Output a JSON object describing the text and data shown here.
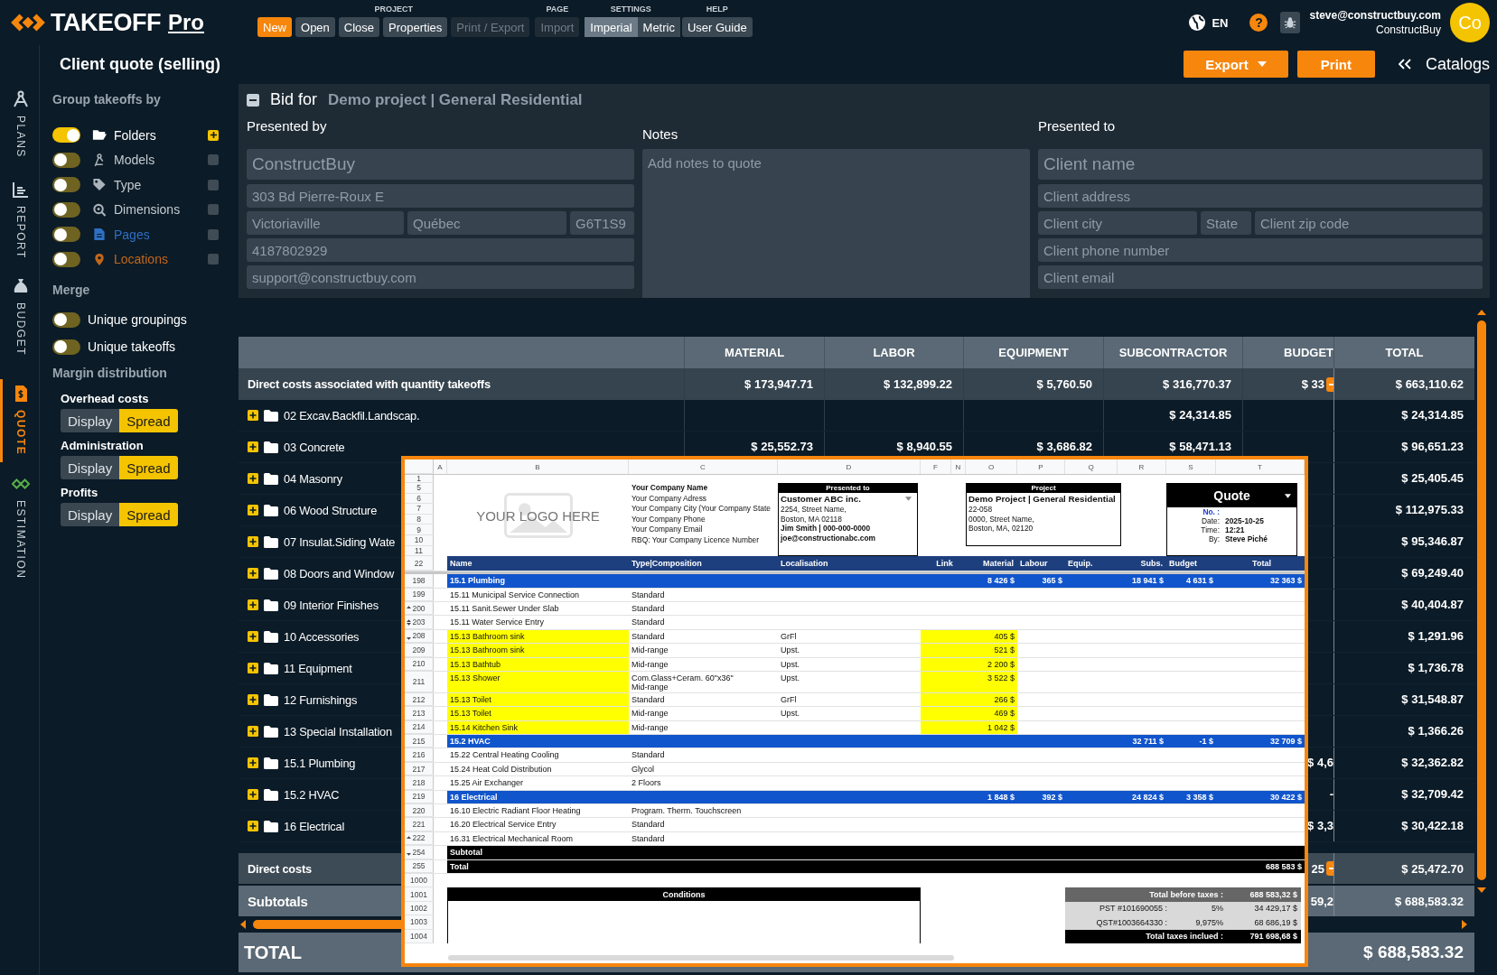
{
  "topbar": {
    "logo": {
      "name": "TAKEOFF",
      "suffix": "Pro"
    },
    "groups": [
      {
        "label": "PROJECT",
        "buttons": [
          {
            "label": "New",
            "kind": "accent",
            "selected": false,
            "disabled": false
          },
          {
            "label": "Open",
            "kind": "plain",
            "selected": false,
            "disabled": false
          },
          {
            "label": "Close",
            "kind": "plain",
            "selected": false,
            "disabled": false
          },
          {
            "label": "Properties",
            "kind": "plain",
            "selected": false,
            "disabled": false
          },
          {
            "label": "Print / Export",
            "kind": "plain",
            "selected": false,
            "disabled": true
          }
        ]
      },
      {
        "label": "PAGE",
        "buttons": [
          {
            "label": "Import",
            "kind": "plain",
            "selected": false,
            "disabled": true
          }
        ]
      },
      {
        "label": "SETTINGS",
        "buttons": [
          {
            "label": "Imperial",
            "kind": "segment",
            "selected": true,
            "disabled": false
          },
          {
            "label": "Metric",
            "kind": "segment",
            "selected": false,
            "disabled": false
          }
        ]
      },
      {
        "label": "HELP",
        "buttons": [
          {
            "label": "User Guide",
            "kind": "plain",
            "selected": false,
            "disabled": false
          }
        ]
      }
    ],
    "language": "EN",
    "help": "?",
    "user": {
      "email": "steve@constructbuy.com",
      "company": "ConstructBuy",
      "initials": "Co"
    }
  },
  "rail": [
    {
      "label": "PLANS",
      "selected": false
    },
    {
      "label": "REPORT",
      "selected": false
    },
    {
      "label": "BUDGET",
      "selected": false
    },
    {
      "label": "QUOTE",
      "selected": true
    },
    {
      "label": "ESTIMATION",
      "selected": false
    }
  ],
  "header": {
    "title": "Client quote (selling)",
    "export": "Export",
    "print": "Print",
    "catalogs": "Catalogs"
  },
  "sidebar": {
    "group_title": "Group takeoffs by",
    "groupings": [
      {
        "label": "Folders",
        "on": true,
        "checked": true,
        "color": "#ffffff"
      },
      {
        "label": "Models",
        "on": false,
        "checked": false,
        "color": "#c3cbd2"
      },
      {
        "label": "Type",
        "on": false,
        "checked": false,
        "color": "#c3cbd2"
      },
      {
        "label": "Dimensions",
        "on": false,
        "checked": false,
        "color": "#c3cbd2"
      },
      {
        "label": "Pages",
        "on": false,
        "checked": false,
        "color": "#2f6fc4"
      },
      {
        "label": "Locations",
        "on": false,
        "checked": false,
        "color": "#c2661a"
      }
    ],
    "merge_title": "Merge",
    "merge": [
      {
        "label": "Unique groupings",
        "on": false
      },
      {
        "label": "Unique takeoffs",
        "on": false
      }
    ],
    "margin_title": "Margin distribution",
    "margins": [
      {
        "label": "Overhead costs",
        "options": [
          {
            "label": "Display",
            "selected": false
          },
          {
            "label": "Spread",
            "selected": true
          }
        ]
      },
      {
        "label": "Administration",
        "options": [
          {
            "label": "Display",
            "selected": false
          },
          {
            "label": "Spread",
            "selected": true
          }
        ]
      },
      {
        "label": "Profits",
        "options": [
          {
            "label": "Display",
            "selected": false
          },
          {
            "label": "Spread",
            "selected": true
          }
        ]
      }
    ]
  },
  "bid": {
    "title": "Bid for",
    "project": "Demo project | General Residential",
    "presented_by": {
      "label": "Presented by",
      "name": {
        "placeholder": "ConstructBuy"
      },
      "address": {
        "placeholder": "303 Bd Pierre-Roux E"
      },
      "city": {
        "placeholder": "Victoriaville"
      },
      "state": {
        "placeholder": "Québec"
      },
      "zip": {
        "placeholder": "G6T1S9"
      },
      "phone": {
        "placeholder": "4187802929"
      },
      "email": {
        "placeholder": "support@constructbuy.com"
      }
    },
    "notes": {
      "label": "Notes",
      "placeholder": "Add notes to quote"
    },
    "presented_to": {
      "label": "Presented to",
      "name": {
        "placeholder": "Client name"
      },
      "address": {
        "placeholder": "Client address"
      },
      "city": {
        "placeholder": "Client city"
      },
      "state": {
        "placeholder": "State"
      },
      "zip": {
        "placeholder": "Client zip code"
      },
      "phone": {
        "placeholder": "Client phone number"
      },
      "email": {
        "placeholder": "Client email"
      }
    }
  },
  "table": {
    "columns": [
      "MATERIAL",
      "LABOR",
      "EQUIPMENT",
      "SUBCONTRACTOR",
      "BUDGET",
      "TOTAL"
    ],
    "direct": {
      "label": "Direct costs associated with quantity takeoffs",
      "material": "$ 173,947.71",
      "labor": "$ 132,899.22",
      "equipment": "$ 5,760.50",
      "subcontractor": "$ 316,770.37",
      "budget": "$ 33",
      "total": "$ 663,110.62",
      "arrow": true
    },
    "rows": [
      {
        "name": "02 Excav.Backfil.Landscap.",
        "subcontractor": "$ 24,314.85",
        "total": "$ 24,314.85"
      },
      {
        "name": "03 Concrete",
        "material": "$ 25,552.73",
        "labor": "$ 8,940.55",
        "equipment": "$ 3,686.82",
        "subcontractor": "$ 58,471.13",
        "total": "$ 96,651.23"
      },
      {
        "name": "04 Masonry",
        "total": "$ 25,405.45"
      },
      {
        "name": "06 Wood Structure",
        "total": "$ 112,975.33"
      },
      {
        "name": "07 Insulat.Siding Wate",
        "total": "$ 95,346.87"
      },
      {
        "name": "08 Doors and Window",
        "total": "$ 69,249.40"
      },
      {
        "name": "09 Interior Finishes",
        "total": "$ 40,404.87"
      },
      {
        "name": "10 Accessories",
        "total": "$ 1,291.96"
      },
      {
        "name": "11 Equipment",
        "total": "$ 1,736.78"
      },
      {
        "name": "12 Furnishings",
        "total": "$ 31,548.87"
      },
      {
        "name": "13 Special Installation",
        "total": "$ 1,366.26"
      },
      {
        "name": "15.1 Plumbing",
        "budget": "$ 4,6",
        "total": "$ 32,362.82"
      },
      {
        "name": "15.2 HVAC",
        "budget": "-",
        "total": "$ 32,709.42"
      },
      {
        "name": "16 Electrical",
        "budget": "$ 3,3",
        "total": "$ 30,422.18"
      }
    ],
    "summary": [
      {
        "kind": "direct",
        "label": "Direct costs",
        "budget": "25",
        "total": "$ 25,472.70",
        "arrow": true
      },
      {
        "kind": "subtotal",
        "label": "Subtotals",
        "budget": "59,2",
        "total": "$ 688,583.32",
        "arrow": false
      }
    ],
    "grand": {
      "label": "TOTAL",
      "total": "$ 688,583.32"
    }
  },
  "sheet": {
    "columns": [
      "A",
      "B",
      "C",
      "D",
      "F",
      "N",
      "O",
      "P",
      "Q",
      "R",
      "S",
      "T"
    ],
    "top_rows": [
      "1",
      "5",
      "6",
      "7",
      "8",
      "9",
      "10",
      "11"
    ],
    "logo_text": "YOUR LOGO HERE",
    "company": [
      "Your Company Name",
      "Your Company Adress",
      "Your Company City (Your Company State",
      "Your Company Phone",
      "Your Company Email",
      "RBQ: Your Company Licence Number"
    ],
    "presented_to": {
      "title": "Presented to",
      "name": "Customer ABC inc.",
      "lines": [
        "2254, Street Name,",
        "Boston, MA 02118"
      ],
      "contact": "Jim Smith | 000-000-0000",
      "email": "joe@constructionabc.com"
    },
    "project": {
      "title": "Project",
      "name": "Demo Project | General Residential",
      "lines": [
        "22-058",
        "0000, Street Name,",
        "Boston, MA, 02120"
      ]
    },
    "quote": {
      "title": "Quote",
      "fields": [
        {
          "kind": "number",
          "label": "No. :"
        },
        {
          "kind": "plain",
          "label": "Date:",
          "value": "2025-10-25"
        },
        {
          "kind": "plain",
          "label": "Time:",
          "value": "12:21"
        },
        {
          "kind": "plain",
          "label": "By:",
          "value": "Steve Piché"
        }
      ]
    },
    "header_row": {
      "number": "22",
      "cells": [
        "Name",
        "Type|Composition",
        "Localisation",
        "Link",
        "Material",
        "Labour",
        "Equip.",
        "Subs.",
        "Budget",
        "Total"
      ]
    },
    "rows": [
      {
        "number": "198",
        "kind": "group",
        "highlighted": false,
        "fold_up": false,
        "fold_down": false,
        "name": "15.1 Plumbing",
        "material": "8 426 $",
        "labour": "365 $",
        "subs": "18 941 $",
        "budget": "4 631 $",
        "total": "32 363 $"
      },
      {
        "number": "199",
        "kind": "item",
        "highlighted": false,
        "fold_up": false,
        "fold_down": false,
        "name": "15.11 Municipal Service Connection",
        "type": "Standard"
      },
      {
        "number": "200",
        "kind": "item",
        "highlighted": false,
        "fold_up": true,
        "fold_down": false,
        "name": "15.11 Sanit.Sewer Under Slab",
        "type": "Standard"
      },
      {
        "number": "203",
        "kind": "item",
        "highlighted": false,
        "fold_up": true,
        "fold_down": true,
        "name": "15.11 Water Service Entry",
        "type": "Standard"
      },
      {
        "number": "208",
        "kind": "item",
        "highlighted": true,
        "fold_up": false,
        "fold_down": true,
        "name": "15.13 Bathroom sink",
        "type": "Standard",
        "location": "GrFl",
        "material": "405 $"
      },
      {
        "number": "209",
        "kind": "item",
        "highlighted": true,
        "fold_up": false,
        "fold_down": false,
        "name": "15.13 Bathroom sink",
        "type": "Mid-range",
        "location": "Upst.",
        "material": "521 $"
      },
      {
        "number": "210",
        "kind": "item",
        "highlighted": true,
        "fold_up": false,
        "fold_down": false,
        "name": "15.13 Bathtub",
        "type": "Mid-range",
        "location": "Upst.",
        "material": "2 200 $"
      },
      {
        "number": "211",
        "kind": "item",
        "highlighted": true,
        "fold_up": false,
        "fold_down": false,
        "name": "15.13 Shower",
        "type": "Com.Glass+Ceram. 60\"x36\"\nMid-range",
        "location": "Upst.",
        "material": "3 522 $"
      },
      {
        "number": "212",
        "kind": "item",
        "highlighted": true,
        "fold_up": false,
        "fold_down": false,
        "name": "15.13 Toilet",
        "type": "Standard",
        "location": "GrFl",
        "material": "266 $"
      },
      {
        "number": "213",
        "kind": "item",
        "highlighted": true,
        "fold_up": false,
        "fold_down": false,
        "name": "15.13 Toilet",
        "type": "Mid-range",
        "location": "Upst.",
        "material": "469 $"
      },
      {
        "number": "214",
        "kind": "item",
        "highlighted": true,
        "fold_up": false,
        "fold_down": false,
        "name": "15.14 Kitchen Sink",
        "type": "Mid-range",
        "material": "1 042 $"
      },
      {
        "number": "215",
        "kind": "group",
        "highlighted": false,
        "fold_up": false,
        "fold_down": false,
        "name": "15.2 HVAC",
        "subs": "32 711 $",
        "budget": "-1 $",
        "total": "32 709 $"
      },
      {
        "number": "216",
        "kind": "item",
        "highlighted": false,
        "fold_up": false,
        "fold_down": false,
        "name": "15.22 Central Heating Cooling",
        "type": "Standard"
      },
      {
        "number": "217",
        "kind": "item",
        "highlighted": false,
        "fold_up": false,
        "fold_down": false,
        "name": "15.24 Heat Cold Distribution",
        "type": "Glycol"
      },
      {
        "number": "218",
        "kind": "item",
        "highlighted": false,
        "fold_up": false,
        "fold_down": false,
        "name": "15.25 Air Exchanger",
        "type": "2 Floors"
      },
      {
        "number": "219",
        "kind": "group",
        "highlighted": false,
        "fold_up": false,
        "fold_down": false,
        "name": "16 Electrical",
        "material": "1 848 $",
        "labour": "392 $",
        "subs": "24 824 $",
        "budget": "3 358 $",
        "total": "30 422 $"
      },
      {
        "number": "220",
        "kind": "item",
        "highlighted": false,
        "fold_up": false,
        "fold_down": false,
        "name": "16.10 Electric Radiant Floor Heating",
        "type": "Program. Therm. Touchscreen"
      },
      {
        "number": "221",
        "kind": "item",
        "highlighted": false,
        "fold_up": false,
        "fold_down": false,
        "name": "16.20 Electrical Service Entry",
        "type": "Standard"
      },
      {
        "number": "222",
        "kind": "item",
        "highlighted": false,
        "fold_up": true,
        "fold_down": false,
        "name": "16.31 Electrical Mechanical Room",
        "type": "Standard"
      },
      {
        "number": "254",
        "kind": "total",
        "highlighted": false,
        "fold_up": false,
        "fold_down": true,
        "name": "Subtotal"
      },
      {
        "number": "255",
        "kind": "total",
        "highlighted": false,
        "fold_up": false,
        "fold_down": false,
        "name": "Total",
        "total": "688 583 $"
      }
    ],
    "bottom_rows": [
      "1000",
      "1001",
      "1002",
      "1003",
      "1004"
    ],
    "conditions": "Conditions",
    "taxes": [
      {
        "kind": "head",
        "label": "Total before taxes :",
        "value": "688 583,32 $"
      },
      {
        "kind": "line",
        "label": "PST #101690055 :",
        "rate": "5%",
        "value": "34 429,17 $"
      },
      {
        "kind": "line",
        "label": "QST#1003664330 :",
        "rate": "9,975%",
        "value": "68 686,19 $"
      },
      {
        "kind": "foot",
        "label": "Total taxes inclued :",
        "value": "791 698,68 $"
      }
    ]
  }
}
